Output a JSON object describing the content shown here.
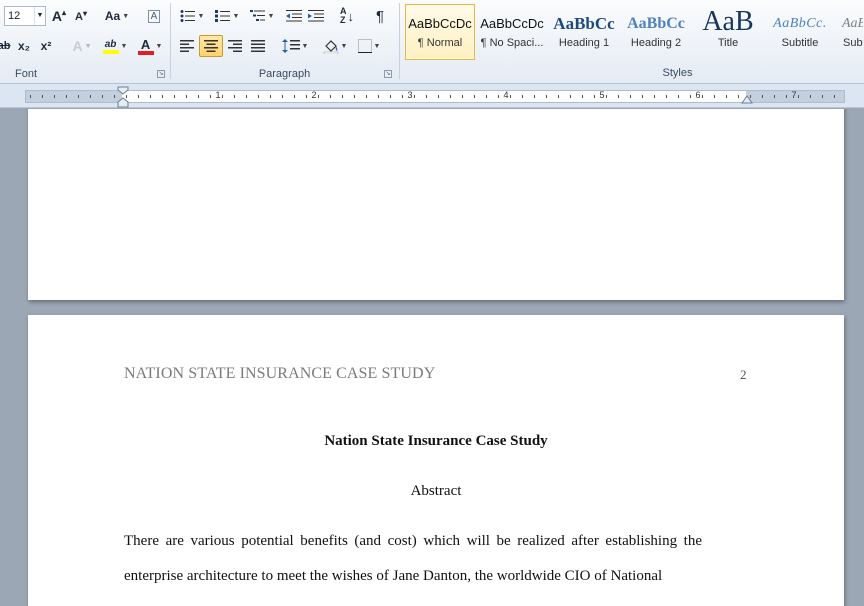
{
  "ribbon": {
    "font": {
      "label": "Font",
      "size": "12",
      "grow_glyph": "A",
      "shrink_glyph": "A",
      "change_case_glyph": "Aa",
      "clear_format_glyph": "A",
      "subscript_glyph": "x₂",
      "superscript_glyph": "x²",
      "text_effects_glyph": "A",
      "highlight_glyph": "ab",
      "font_color_glyph": "A"
    },
    "paragraph": {
      "label": "Paragraph",
      "pilcrow_glyph": "¶"
    },
    "styles": {
      "label": "Styles",
      "items": [
        {
          "sample": "AaBbCcDc",
          "name": "¶ Normal"
        },
        {
          "sample": "AaBbCcDc",
          "name": "¶ No Spaci..."
        },
        {
          "sample": "AaBbCc",
          "name": "Heading 1"
        },
        {
          "sample": "AaBbCc",
          "name": "Heading 2"
        },
        {
          "sample": "AaB",
          "name": "Title"
        },
        {
          "sample": "AaBbCc.",
          "name": "Subtitle"
        },
        {
          "sample": "AaB",
          "name": "Subt"
        }
      ]
    }
  },
  "ruler": {
    "numbers": [
      "1",
      "2",
      "3",
      "4",
      "5",
      "6",
      "7"
    ]
  },
  "document": {
    "running_head": "NATION STATE INSURANCE CASE STUDY",
    "page_number": "2",
    "title": "Nation State Insurance Case Study",
    "abstract_heading": "Abstract",
    "body_lines": [
      "There are various potential benefits (and cost) which will be realized after establishing the",
      "enterprise architecture to meet the wishes of Jane Danton, the worldwide CIO of National"
    ]
  },
  "colors": {
    "ribbon_bg": "#e4ebf4",
    "selected_style": "#ffd36a",
    "workspace_bg": "#9ba7b4",
    "heading_blue": "#1f497d",
    "heading2_blue": "#4f81bd",
    "highlight_yellow": "#ffff00",
    "font_red": "#e02020"
  }
}
